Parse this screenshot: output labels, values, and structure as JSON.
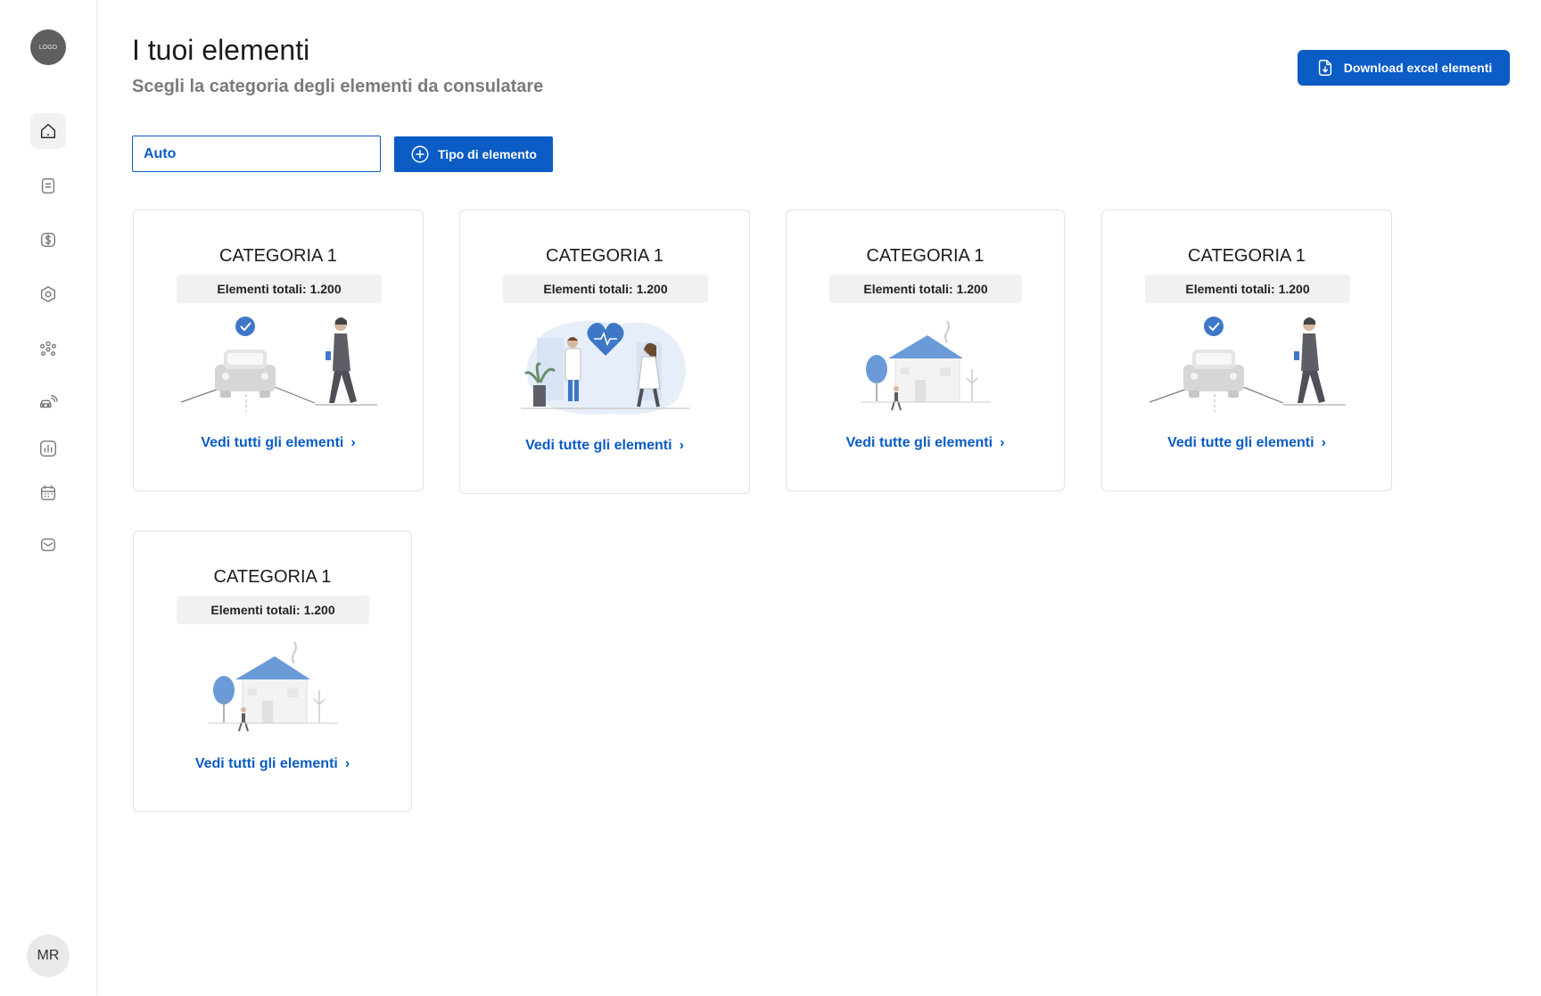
{
  "sidebar": {
    "logo_text": "LOGO",
    "nav_items": [
      {
        "icon": "home-icon",
        "active": true
      },
      {
        "icon": "clipboard-icon",
        "active": false
      },
      {
        "icon": "dollar-icon",
        "active": false
      },
      {
        "icon": "hexagon-icon",
        "active": false
      },
      {
        "icon": "people-group-icon",
        "active": false
      },
      {
        "icon": "car-connected-icon",
        "active": false
      },
      {
        "icon": "chart-icon",
        "active": false
      },
      {
        "icon": "calendar-icon",
        "active": false
      },
      {
        "icon": "mail-icon",
        "active": false
      }
    ],
    "user_initials": "MR"
  },
  "header": {
    "title": "I tuoi elementi",
    "subtitle": "Scegli la categoria degli elementi da consulatare",
    "download_label": "Download excel elementi"
  },
  "filter": {
    "input_value": "Auto",
    "type_button_label": "Tipo di elemento"
  },
  "colors": {
    "primary": "#0b5cc5",
    "illustration_blue": "#6a9bd8"
  },
  "cards": [
    {
      "title": "CATEGORIA 1",
      "badge": "Elementi totali: 1.200",
      "link": "Vedi tutti gli elementi",
      "illustration": "car-walker"
    },
    {
      "title": "CATEGORIA 1",
      "badge": "Elementi totali: 1.200",
      "link": "Vedi tutte gli elementi",
      "illustration": "health-doctors"
    },
    {
      "title": "CATEGORIA 1",
      "badge": "Elementi totali: 1.200",
      "link": "Vedi tutte gli elementi",
      "illustration": "house"
    },
    {
      "title": "CATEGORIA 1",
      "badge": "Elementi totali: 1.200",
      "link": "Vedi tutte gli elementi",
      "illustration": "car-walker"
    },
    {
      "title": "CATEGORIA 1",
      "badge": "Elementi totali: 1.200",
      "link": "Vedi tutti gli elementi",
      "illustration": "house"
    }
  ]
}
